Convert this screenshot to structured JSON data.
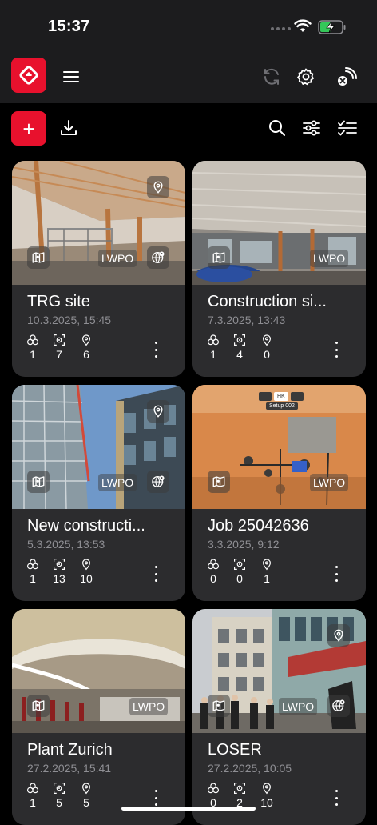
{
  "status_bar": {
    "time": "15:37"
  },
  "header": {
    "logo_icon": "app-logo-icon",
    "menu_icon": "hamburger-menu-icon",
    "sync_icon": "sync-icon",
    "settings_icon": "gear-icon",
    "device_icon": "device-disconnected-icon"
  },
  "toolbar": {
    "add_label": "+",
    "icons": [
      "download-icon",
      "search-icon",
      "filter-icon",
      "checklist-icon"
    ]
  },
  "brand_color": "#e8112d",
  "projects": [
    {
      "title": "TRG site",
      "date": "10.3.2025, 15:45",
      "tag": "LWPO",
      "stats": {
        "scans": "1",
        "targets": "7",
        "locations": "6"
      }
    },
    {
      "title": "Construction si...",
      "date": "7.3.2025, 13:43",
      "tag": "LWPO",
      "stats": {
        "scans": "1",
        "targets": "4",
        "locations": "0"
      }
    },
    {
      "title": "New constructi...",
      "date": "5.3.2025, 13:53",
      "tag": "LWPO",
      "stats": {
        "scans": "1",
        "targets": "13",
        "locations": "10"
      }
    },
    {
      "title": "Job 25042636",
      "date": "3.3.2025, 9:12",
      "tag": "LWPO",
      "stats": {
        "scans": "0",
        "targets": "0",
        "locations": "1"
      }
    },
    {
      "title": "Plant Zurich",
      "date": "27.2.2025, 15:41",
      "tag": "LWPO",
      "stats": {
        "scans": "1",
        "targets": "5",
        "locations": "5"
      }
    },
    {
      "title": "LOSER",
      "date": "27.2.2025, 10:05",
      "tag": "LWPO",
      "stats": {
        "scans": "0",
        "targets": "2",
        "locations": "10"
      }
    }
  ],
  "job_overlay": {
    "setup_label": "Setup 002",
    "badge": "HK"
  }
}
